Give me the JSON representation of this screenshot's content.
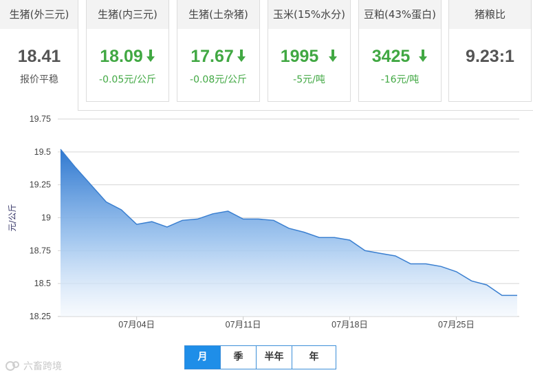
{
  "cards": [
    {
      "title": "生猪(外三元)",
      "value": "18.41",
      "change": "报价平稳",
      "trend": "flat"
    },
    {
      "title": "生猪(内三元)",
      "value": "18.09",
      "change": "-0.05元/公斤",
      "trend": "down"
    },
    {
      "title": "生猪(土杂猪)",
      "value": "17.67",
      "change": "-0.08元/公斤",
      "trend": "down"
    },
    {
      "title": "玉米(15%水分)",
      "value": "1995",
      "change": "-5元/吨",
      "trend": "down"
    },
    {
      "title": "豆粕(43%蛋白)",
      "value": "3425",
      "change": "-16元/吨",
      "trend": "down"
    },
    {
      "title": "猪粮比",
      "value": "9.23:1",
      "change": "",
      "trend": "none"
    }
  ],
  "colors": {
    "down": "#41a843",
    "accent": "#1f8ee8",
    "series": "#3a7fd0"
  },
  "chart_data": {
    "type": "area",
    "ylabel": "元/公斤",
    "ylim": [
      18.25,
      19.75
    ],
    "yticks": [
      19.75,
      19.5,
      19.25,
      19,
      18.75,
      18.5,
      18.25
    ],
    "ytick_labels": [
      "19.75",
      "19.5",
      "19.25",
      "19",
      "18.75",
      "18.5",
      "18.25"
    ],
    "xlim": [
      0,
      30
    ],
    "xticks": [
      {
        "x": 5,
        "label": "07月04日"
      },
      {
        "x": 12,
        "label": "07月11日"
      },
      {
        "x": 19,
        "label": "07月18日"
      },
      {
        "x": 26,
        "label": "07月25日"
      }
    ],
    "grid": true,
    "series": [
      {
        "x": [
          0,
          1,
          2,
          3,
          4,
          5,
          6,
          7,
          8,
          9,
          10,
          11,
          12,
          13,
          14,
          15,
          16,
          17,
          18,
          19,
          20,
          21,
          22,
          23,
          24,
          25,
          26,
          27,
          28,
          29,
          30
        ],
        "values": [
          19.52,
          19.38,
          19.25,
          19.12,
          19.06,
          18.95,
          18.97,
          18.93,
          18.98,
          18.99,
          19.03,
          19.05,
          18.99,
          18.99,
          18.98,
          18.92,
          18.89,
          18.85,
          18.85,
          18.83,
          18.75,
          18.73,
          18.71,
          18.65,
          18.65,
          18.63,
          18.59,
          18.52,
          18.49,
          18.41,
          18.41
        ]
      }
    ]
  },
  "period_buttons": [
    "月",
    "季",
    "半年",
    "年"
  ],
  "watermark": "六畜跨境"
}
